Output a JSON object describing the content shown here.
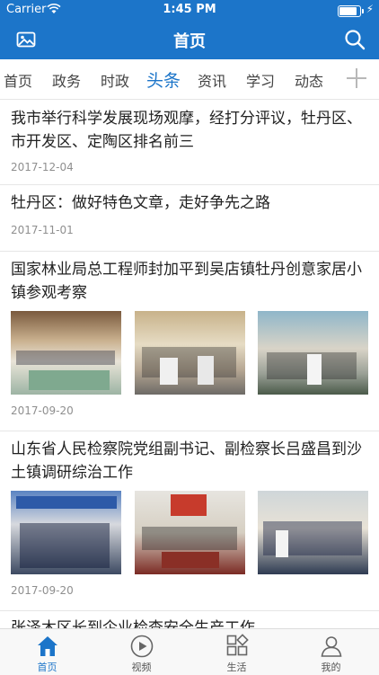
{
  "status_bar": {
    "carrier": "Carrier",
    "time": "1:45 PM"
  },
  "nav": {
    "title": "首页",
    "left_icon": "image-icon",
    "right_icon": "search-icon"
  },
  "tabs": [
    {
      "label": "首页",
      "active": false
    },
    {
      "label": "政务",
      "active": false
    },
    {
      "label": "时政",
      "active": false
    },
    {
      "label": "头条",
      "active": true
    },
    {
      "label": "资讯",
      "active": false
    },
    {
      "label": "学习",
      "active": false
    },
    {
      "label": "动态",
      "active": false
    }
  ],
  "feed": [
    {
      "headline": "我市举行科学发展现场观摩，经打分评议，牡丹区、市开发区、定陶区排名前三",
      "date": "2017-12-04"
    },
    {
      "headline": "牡丹区：做好特色文章，走好争先之路",
      "date": "2017-11-01"
    },
    {
      "headline": "国家林业局总工程师封加平到吴店镇牡丹创意家居小镇参观考察",
      "date": "2017-09-20"
    },
    {
      "headline": "山东省人民检察院党组副书记、副检察长吕盛昌到沙土镇调研综治工作",
      "date": "2017-09-20"
    },
    {
      "headline": "张泽木区长到企业检查安全生产工作"
    }
  ],
  "tab_bar": [
    {
      "label": "首页",
      "icon": "home-icon",
      "active": true
    },
    {
      "label": "视频",
      "icon": "play-icon",
      "active": false
    },
    {
      "label": "生活",
      "icon": "grid-icon",
      "active": false
    },
    {
      "label": "我的",
      "icon": "user-icon",
      "active": false
    }
  ],
  "colors": {
    "primary": "#1c75c9",
    "text": "#222222",
    "muted": "#8f8f8f"
  }
}
